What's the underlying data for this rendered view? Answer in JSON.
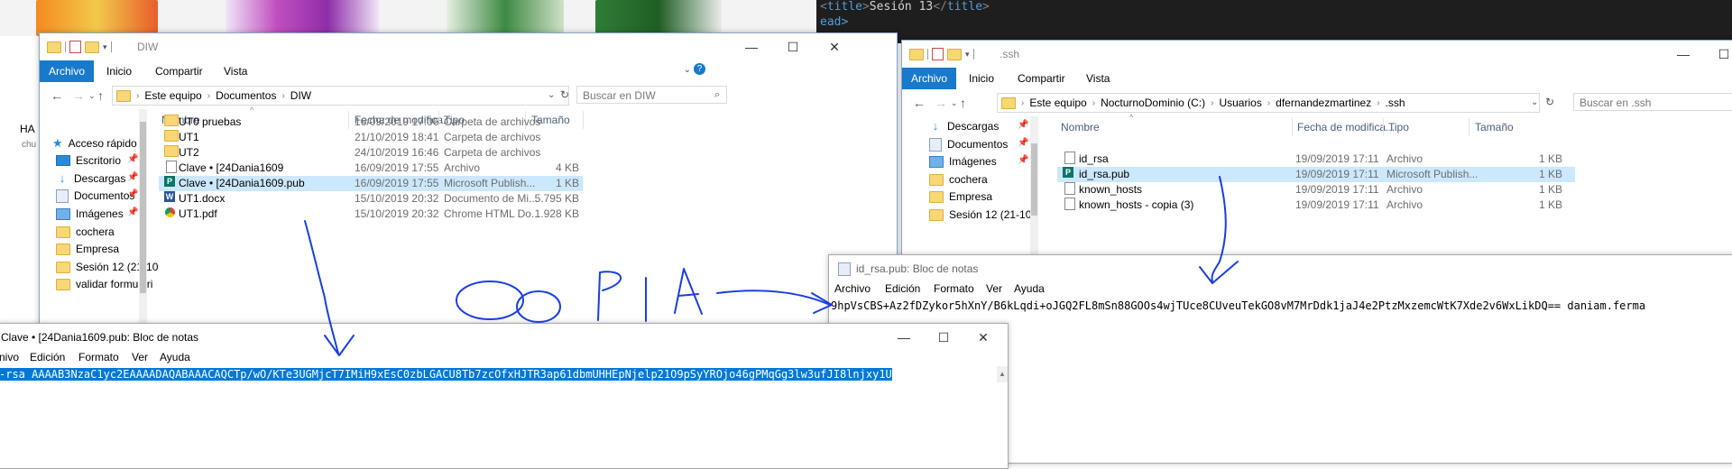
{
  "background": {
    "partial_text_left": "HA",
    "partial_text_left2": "chu",
    "code_line1": "<title>Sesión 13</title>",
    "code_line2": "ead>",
    "code_title_open": "<title>",
    "code_title_text": "Sesión 13",
    "code_title_close": "</title>"
  },
  "explorer_left": {
    "title": "DIW",
    "ribbon_tabs": [
      "Archivo",
      "Inicio",
      "Compartir",
      "Vista"
    ],
    "breadcrumbs": [
      "Este equipo",
      "Documentos",
      "DIW"
    ],
    "search_placeholder": "Buscar en DIW",
    "nav_items": [
      "Acceso rápido",
      "Escritorio",
      "Descargas",
      "Documentos",
      "Imágenes",
      "cochera",
      "Empresa",
      "Sesión 12 (21-10",
      "validar formulari"
    ],
    "columns": [
      "Nombre",
      "Fecha de modifica...",
      "Tipo",
      "Tamaño"
    ],
    "files": [
      {
        "name": "UT0 pruebas",
        "date": "16/09/2019 17:06",
        "type": "Carpeta de archivos",
        "size": ""
      },
      {
        "name": "UT1",
        "date": "21/10/2019 18:41",
        "type": "Carpeta de archivos",
        "size": ""
      },
      {
        "name": "UT2",
        "date": "24/10/2019 16:46",
        "type": "Carpeta de archivos",
        "size": ""
      },
      {
        "name": "Clave • [24Dania1609",
        "date": "16/09/2019 17:55",
        "type": "Archivo",
        "size": "4 KB"
      },
      {
        "name": "Clave • [24Dania1609.pub",
        "date": "16/09/2019 17:55",
        "type": "Microsoft Publish...",
        "size": "1 KB"
      },
      {
        "name": "UT1.docx",
        "date": "15/10/2019 20:32",
        "type": "Documento de Mi...",
        "size": "5.795 KB"
      },
      {
        "name": "UT1.pdf",
        "date": "15/10/2019 20:32",
        "type": "Chrome HTML Do...",
        "size": "1.928 KB"
      }
    ]
  },
  "explorer_right": {
    "title": ".ssh",
    "ribbon_tabs": [
      "Archivo",
      "Inicio",
      "Compartir",
      "Vista"
    ],
    "breadcrumbs": [
      "Este equipo",
      "NocturnoDominio (C:)",
      "Usuarios",
      "dfernandezmartinez",
      ".ssh"
    ],
    "search_placeholder": "Buscar en .ssh",
    "nav_items": [
      "Descargas",
      "Documentos",
      "Imágenes",
      "cochera",
      "Empresa",
      "Sesión 12 (21-10"
    ],
    "columns": [
      "Nombre",
      "Fecha de modifica...",
      "Tipo",
      "Tamaño"
    ],
    "files": [
      {
        "name": "id_rsa",
        "date": "19/09/2019 17:11",
        "type": "Archivo",
        "size": "1 KB"
      },
      {
        "name": "id_rsa.pub",
        "date": "19/09/2019 17:11",
        "type": "Microsoft Publish...",
        "size": "1 KB"
      },
      {
        "name": "known_hosts",
        "date": "19/09/2019 17:11",
        "type": "Archivo",
        "size": "1 KB"
      },
      {
        "name": "known_hosts - copia (3)",
        "date": "19/09/2019 17:11",
        "type": "Archivo",
        "size": "1 KB"
      }
    ]
  },
  "notepad_left": {
    "title": "Clave • [24Dania1609.pub: Bloc de notas",
    "menu": [
      "nivo",
      "Edición",
      "Formato",
      "Ver",
      "Ayuda"
    ],
    "content": "-rsa AAAAB3NzaC1yc2EAAAADAQABAAACAQCTp/wO/KTe3UGMjcT7IMiH9xEsC0zbLGACU8Tb7zcOfxHJTR3ap61dbmUHHEpNjelp21O9pSyYROjo46gPMqGg3lw3ufJI8lnjxy1U"
  },
  "notepad_right": {
    "title": "id_rsa.pub: Bloc de notas",
    "menu": [
      "Archivo",
      "Edición",
      "Formato",
      "Ver",
      "Ayuda"
    ],
    "content": "9hpVsCBS+Az2fDZykor5hXnY/B6kLqdi+oJGQ2FL8mSn88GOOs4wjTUce8CUveuTekGO8vM7MrDdk1jaJ4e2PtzMxzemcWtK7Xde2v6WxLikDQ== daniam.ferma"
  },
  "annotation": {
    "text": "COPIA",
    "color": "#1a3ee0"
  }
}
